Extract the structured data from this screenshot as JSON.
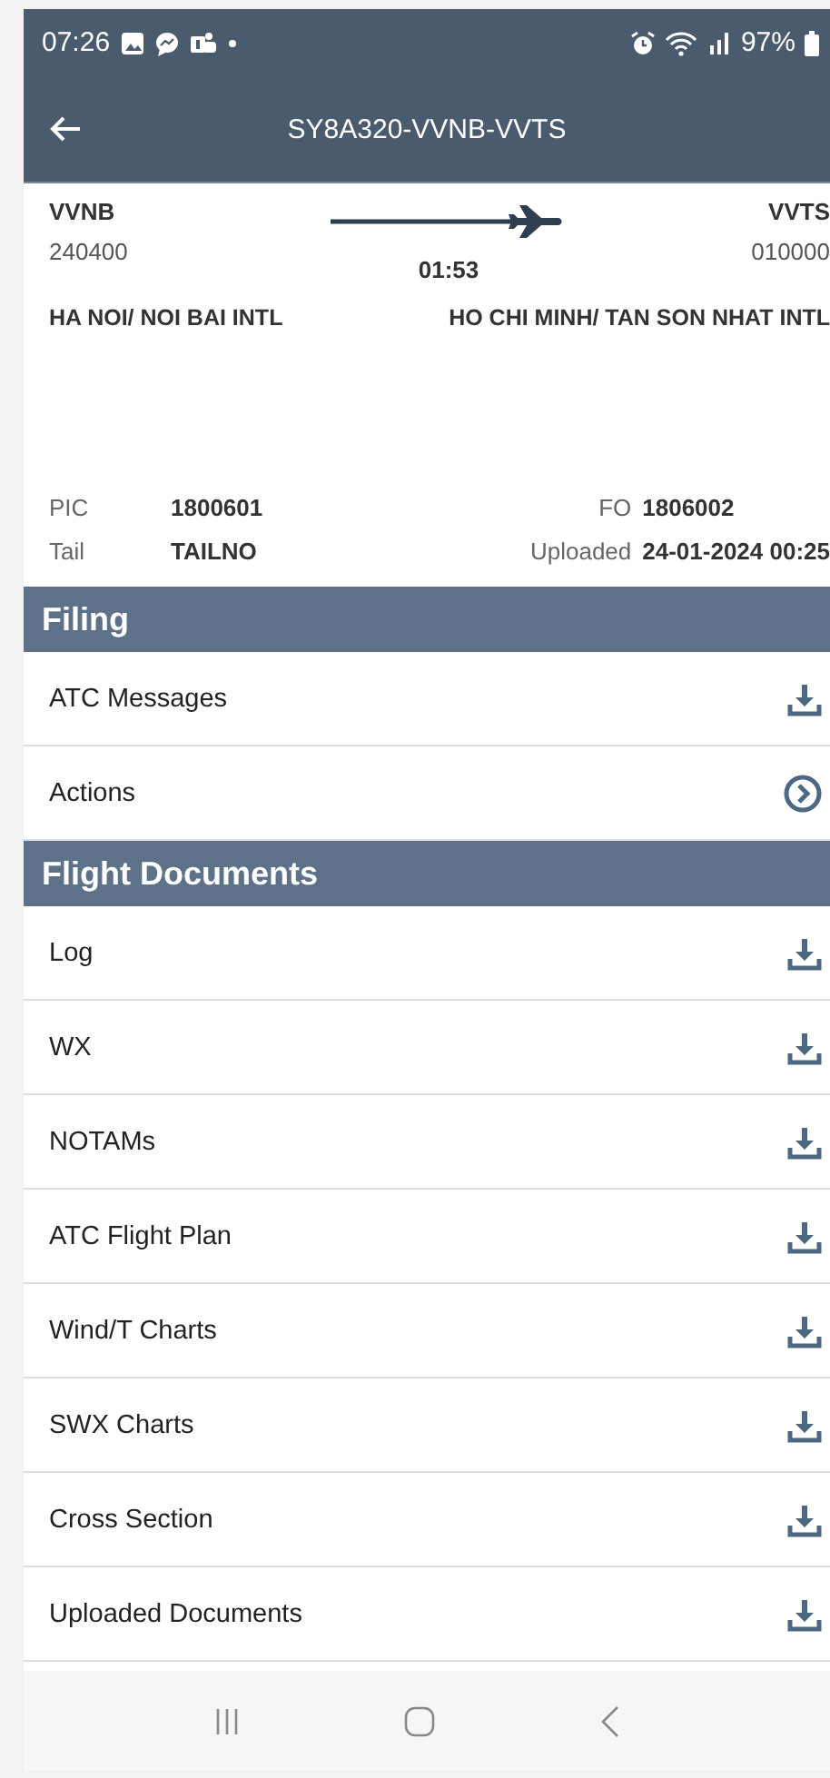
{
  "status_bar": {
    "time": "07:26",
    "battery": "97%"
  },
  "app_bar": {
    "title": "SY8A320-VVNB-VVTS"
  },
  "route": {
    "origin": {
      "code": "VVNB",
      "time": "240400",
      "name": "HA NOI/ NOI BAI INTL"
    },
    "destination": {
      "code": "VVTS",
      "time": "010000",
      "name": "HO CHI MINH/ TAN SON NHAT INTL"
    },
    "duration": "01:53"
  },
  "crew": [
    {
      "label": "PIC",
      "value": "1800601"
    },
    {
      "label": "FO",
      "value": "1806002"
    },
    {
      "label": "Tail",
      "value": "TAILNO"
    },
    {
      "label": "Uploaded",
      "value": "24-01-2024 00:25"
    }
  ],
  "sections": [
    {
      "title": "Filing",
      "items": [
        {
          "label": "ATC Messages",
          "kind": "download"
        },
        {
          "label": "Actions",
          "kind": "open"
        }
      ]
    },
    {
      "title": "Flight Documents",
      "items": [
        {
          "label": "Log",
          "kind": "download"
        },
        {
          "label": "WX",
          "kind": "download"
        },
        {
          "label": "NOTAMs",
          "kind": "download"
        },
        {
          "label": "ATC Flight Plan",
          "kind": "download"
        },
        {
          "label": "Wind/T Charts",
          "kind": "download"
        },
        {
          "label": "SWX Charts",
          "kind": "download"
        },
        {
          "label": "Cross Section",
          "kind": "download"
        },
        {
          "label": "Uploaded Documents",
          "kind": "download"
        }
      ]
    }
  ]
}
